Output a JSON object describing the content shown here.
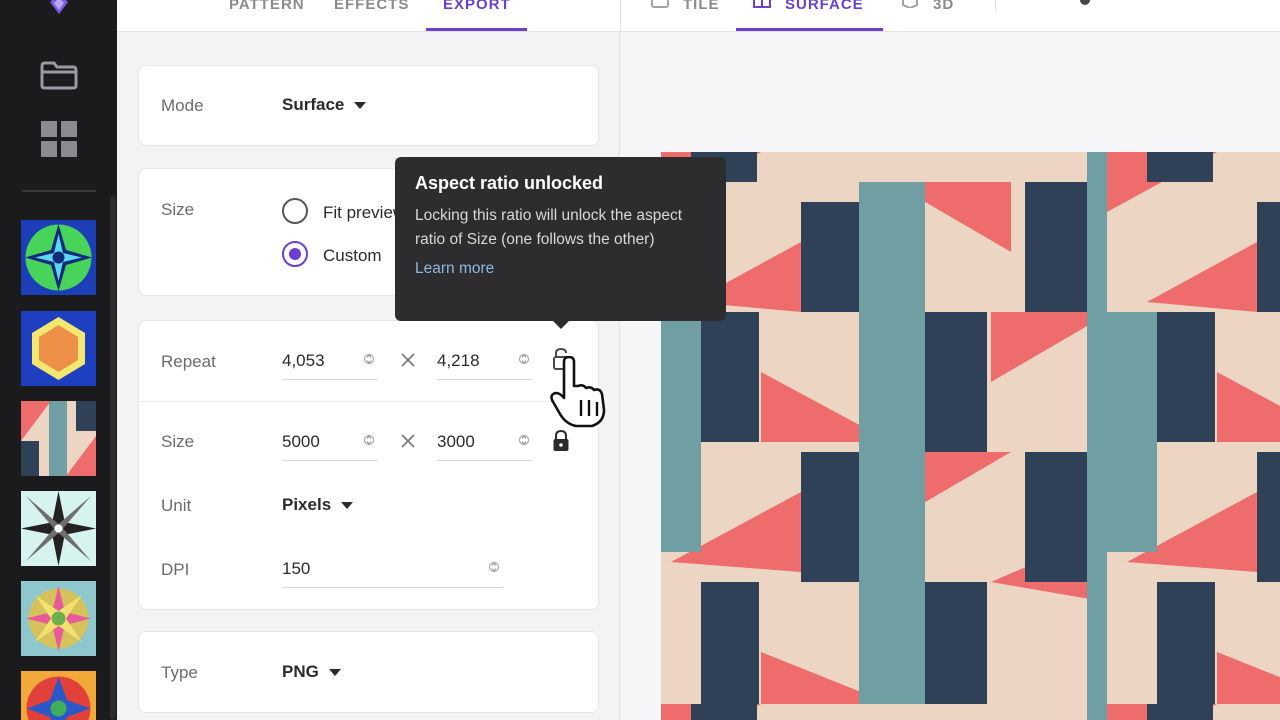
{
  "top_tabs": [
    {
      "label": "PATTERN"
    },
    {
      "label": "EFFECTS"
    },
    {
      "label": "EXPORT"
    }
  ],
  "preview_tabs": [
    {
      "label": "TILE",
      "icon": "tile-icon"
    },
    {
      "label": "SURFACE",
      "icon": "surface-icon"
    },
    {
      "label": "3D",
      "icon": "cube-icon"
    }
  ],
  "active_top_tab": "EXPORT",
  "active_preview_tab": "SURFACE",
  "mode": {
    "label": "Mode",
    "value": "Surface"
  },
  "size_choice": {
    "label": "Size",
    "options": [
      {
        "label": "Fit preview",
        "selected": false
      },
      {
        "label": "Custom",
        "selected": true
      }
    ]
  },
  "repeat": {
    "label": "Repeat",
    "width": "4,053",
    "height": "4,218",
    "lock_state": "unlocked"
  },
  "size": {
    "label": "Size",
    "width": "5000",
    "height": "3000",
    "lock_state": "locked"
  },
  "unit": {
    "label": "Unit",
    "value": "Pixels"
  },
  "dpi": {
    "label": "DPI",
    "value": "150"
  },
  "type": {
    "label": "Type",
    "value": "PNG"
  },
  "tooltip": {
    "title": "Aspect ratio unlocked",
    "body": "Locking this ratio will unlock the aspect ratio of Size (one follows the other)",
    "link": "Learn more"
  },
  "colors": {
    "accent": "#6a3fd1",
    "pattern_cream": "#ecd6c3",
    "pattern_teal": "#6f9ea3",
    "pattern_navy": "#2f4156",
    "pattern_coral": "#ef6c6c",
    "rail_bg": "#1b1b1d",
    "tooltip_bg": "#2d2d2f"
  }
}
